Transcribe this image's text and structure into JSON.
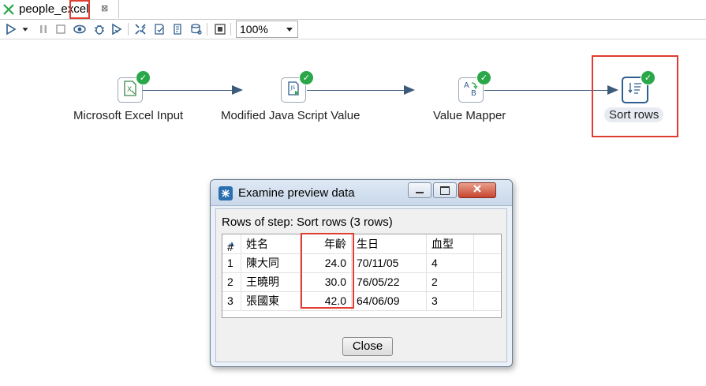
{
  "tab": {
    "title": "people_excel",
    "close_glyph": "⊠"
  },
  "toolbar": {
    "icons": [
      "run-icon",
      "run-dropdown-icon",
      "pause-icon",
      "stop-icon",
      "preview-icon",
      "debug-icon",
      "replay-icon",
      "verify-icon",
      "impact-icon",
      "sql-icon",
      "explore-db-icon",
      "show-results-icon"
    ],
    "zoom": "100%"
  },
  "canvas": {
    "steps": [
      {
        "label": "Microsoft Excel Input",
        "icon": "excel-input-icon"
      },
      {
        "label": "Modified Java Script Value",
        "icon": "javascript-icon"
      },
      {
        "label": "Value Mapper",
        "icon": "value-mapper-icon"
      },
      {
        "label": "Sort rows",
        "icon": "sort-rows-icon"
      }
    ],
    "status_icon": "check-icon"
  },
  "dialog": {
    "title": "Examine preview data",
    "rows_label": "Rows of step: Sort rows (3 rows)",
    "columns": [
      "#",
      "姓名",
      "年齡",
      "生日",
      "血型"
    ],
    "rows": [
      [
        "1",
        "陳大同",
        "24.0",
        "70/11/05",
        "4"
      ],
      [
        "2",
        "王曉明",
        "30.0",
        "76/05/22",
        "2"
      ],
      [
        "3",
        "張國東",
        "42.0",
        "64/06/09",
        "3"
      ]
    ],
    "close_label": "Close"
  },
  "colors": {
    "highlight": "#e03c31",
    "success": "#2aa748",
    "hop": "#3c5a7a"
  }
}
